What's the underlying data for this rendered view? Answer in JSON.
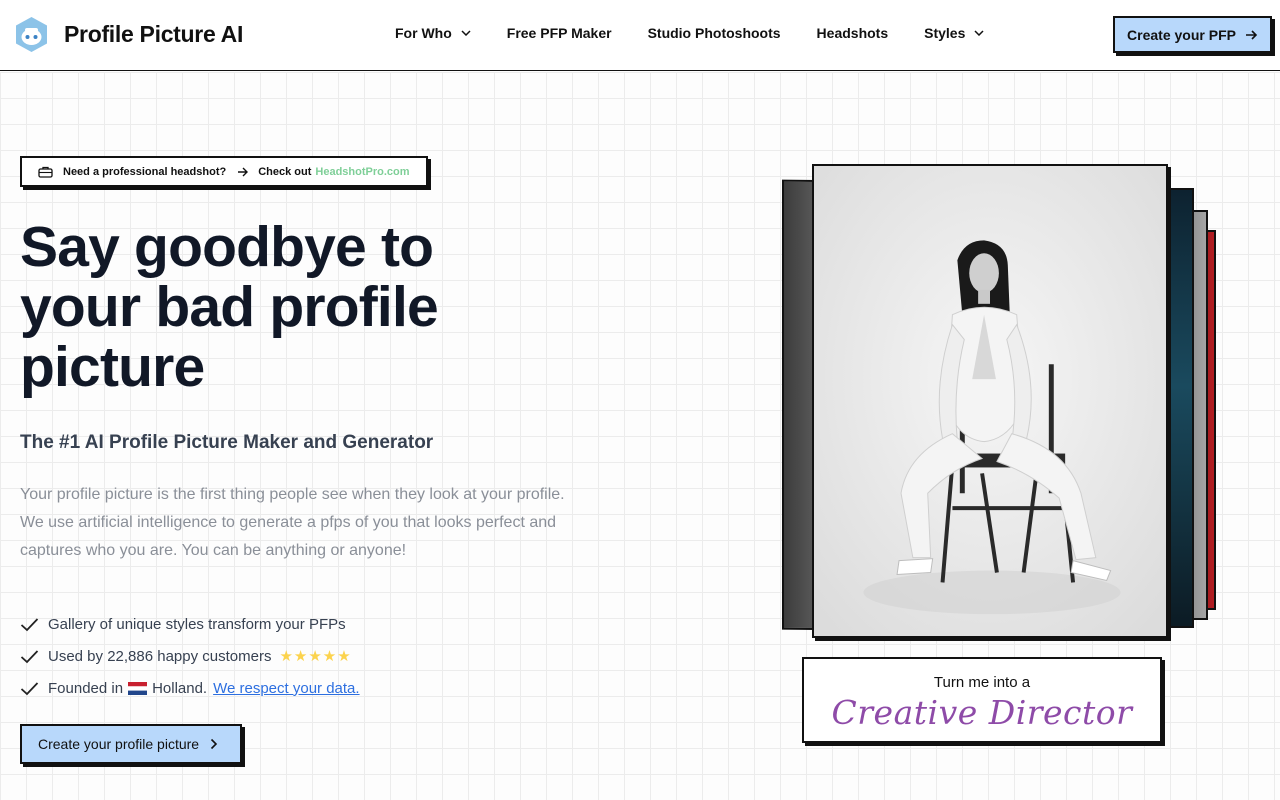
{
  "header": {
    "brand": "Profile Picture AI",
    "nav": [
      {
        "label": "For Who",
        "has_dropdown": true
      },
      {
        "label": "Free PFP Maker",
        "has_dropdown": false
      },
      {
        "label": "Studio Photoshoots",
        "has_dropdown": false
      },
      {
        "label": "Headshots",
        "has_dropdown": false
      },
      {
        "label": "Styles",
        "has_dropdown": true
      }
    ],
    "cta": "Create your PFP"
  },
  "promo": {
    "lead": "Need a professional headshot?",
    "check": "Check out",
    "brand": "HeadshotPro.com",
    "brand_color": "#7fcf98"
  },
  "hero": {
    "title": "Say goodbye to your bad profile picture",
    "subtitle": "The #1 AI Profile Picture Maker and Generator",
    "description": "Your profile picture is the first thing people see when they look at your profile. We use artificial intelligence to generate a pfps of you that looks perfect and captures who you are. You can be anything or anyone!",
    "features": {
      "gallery": "Gallery of unique styles transform your PFPs",
      "customers": "Used by 22,886 happy customers",
      "stars": "★★★★★",
      "founded_prefix": "Founded in",
      "founded_country": "Holland.",
      "privacy_link": "We respect your data."
    },
    "cta": "Create your profile picture"
  },
  "showcase": {
    "caption_lead": "Turn me into a",
    "caption_role": "Creative Director",
    "accent_color": "#8e4ba8"
  },
  "colors": {
    "button_bg": "#b8d8fb",
    "border": "#111111",
    "link": "#2d6fe0",
    "star": "#fcd34d"
  }
}
